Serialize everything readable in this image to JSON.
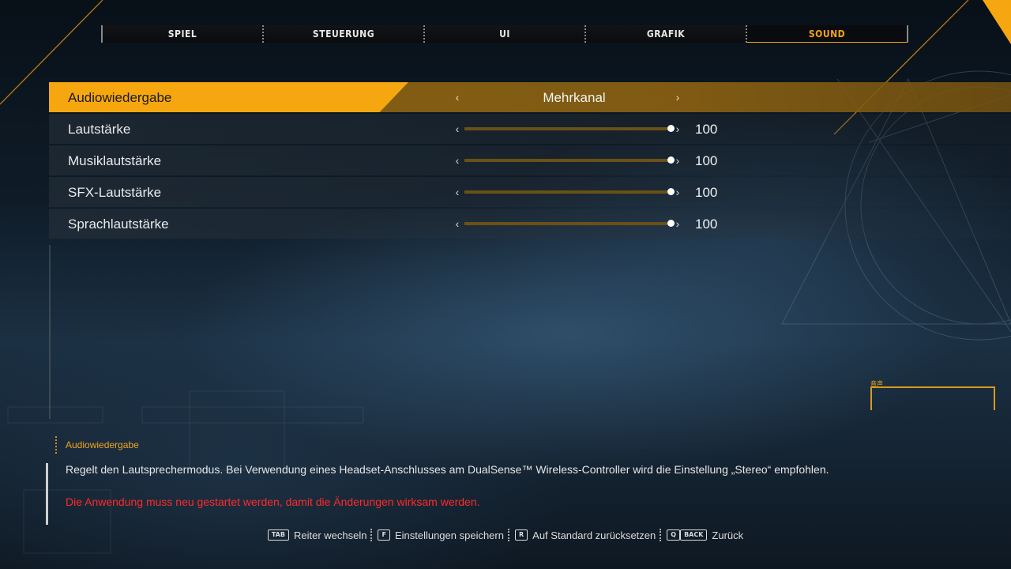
{
  "tabs": [
    {
      "label": "SPIEL",
      "active": false
    },
    {
      "label": "STEUERUNG",
      "active": false
    },
    {
      "label": "UI",
      "active": false
    },
    {
      "label": "GRAFIK",
      "active": false
    },
    {
      "label": "SOUND",
      "active": true
    }
  ],
  "settings": {
    "audio_output": {
      "label": "Audiowiedergabe",
      "value": "Mehrkanal"
    },
    "volume": {
      "label": "Lautstärke",
      "value": 100,
      "display": "100"
    },
    "music_volume": {
      "label": "Musiklautstärke",
      "value": 100,
      "display": "100"
    },
    "sfx_volume": {
      "label": "SFX-Lautstärke",
      "value": 100,
      "display": "100"
    },
    "voice_volume": {
      "label": "Sprachlautstärke",
      "value": 100,
      "display": "100"
    }
  },
  "description": {
    "title": "Audiowiedergabe",
    "text": "Regelt den Lautsprechermodus. Bei Verwendung eines Headset-Anschlusses am DualSense™ Wireless-Controller wird die Einstellung „Stereo“ empfohlen.",
    "warning": "Die Anwendung muss neu gestartet werden, damit die Änderungen wirksam werden."
  },
  "footer": {
    "switch_tab": {
      "key": "TAB",
      "label": "Reiter wechseln"
    },
    "save": {
      "key": "F",
      "label": "Einstellungen speichern"
    },
    "reset": {
      "key": "R",
      "label": "Auf Standard zurücksetzen"
    },
    "back": {
      "key1": "Q",
      "key2": "BACK",
      "label": "Zurück"
    }
  },
  "hud": {
    "label": "音声"
  },
  "colors": {
    "accent": "#f6a70f",
    "accent_dark": "#8c6212",
    "warning": "#ff2a2a",
    "slider_track": "#5c4514"
  },
  "icons": {
    "left_arrow": "chevron-left-icon",
    "right_arrow": "chevron-right-icon"
  }
}
